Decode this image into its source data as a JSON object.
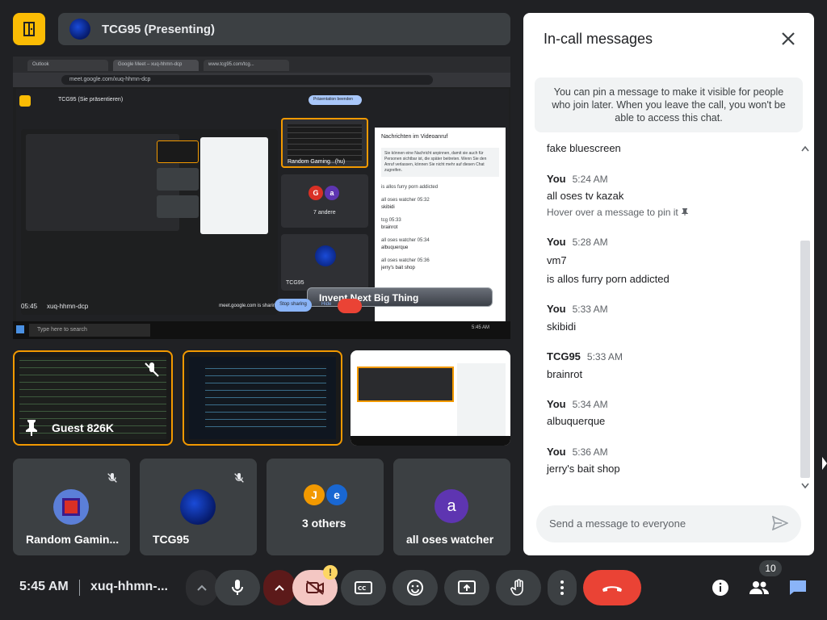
{
  "presenter_bar": {
    "title": "TCG95 (Presenting)"
  },
  "presentation": {
    "tabs": [
      "Outlook",
      "Google Meet – xuq-hhmn-dcp",
      "www.tcg95.com/tcg..."
    ],
    "url": "meet.google.com/xuq-hhmn-dcp",
    "inner_presenter": "TCG95 (Sie präsentieren)",
    "inner_present_btn": "Präsentation beenden",
    "inner_chat_title": "Nachrichten im Videoanruf",
    "inner_chat_info": "Sie können eine Nachricht anpinnen, damit sie auch für Personen sichtbar ist, die später beitreten. Wenn Sie den Anruf verlassen, können Sie nicht mehr auf diesen Chat zugreifen.",
    "inner_chat_lines": [
      "is allos furry porn addicted",
      "all oses watcher 05:32",
      "skibidi",
      "tcg 05:33",
      "brainrot",
      "all oses watcher 05:34",
      "albuquerque",
      "all oses watcher 05:36",
      "jerry's bait shop"
    ],
    "inner_tile_label": "Random Gaming...(hu)",
    "inner_others": "7 andere",
    "inner_tcg": "TCG95",
    "overlay_text": "Invent Next Big Thing",
    "bottom_time": "05:45",
    "bottom_code": "xuq-hhmn-dcp",
    "sharing_text": "meet.google.com is sharing your screen.",
    "stop_sharing": "Stop sharing",
    "hide": "Hide",
    "taskbar_search": "Type here to search",
    "taskbar_time": "5:45 AM"
  },
  "tiles_top": [
    {
      "label": "Guest 826K"
    }
  ],
  "participants": [
    {
      "name": "Random Gamin...",
      "muted": true
    },
    {
      "name": "TCG95",
      "muted": true
    },
    {
      "name": "3 others",
      "avatars": [
        "J",
        "e"
      ]
    },
    {
      "name": "all oses watcher",
      "avatar": "a"
    }
  ],
  "bottom": {
    "time": "5:45 AM",
    "meeting_code": "xuq-hhmn-...",
    "participants_count": "10",
    "camera_warning": "!"
  },
  "chat": {
    "title": "In-call messages",
    "pin_info": "You can pin a message to make it visible for people who join later. When you leave the call, you won't be able to access this chat.",
    "messages": [
      {
        "text": "fake bluescreen"
      },
      {
        "author": "You",
        "time": "5:24 AM",
        "lines": [
          "all oses tv kazak"
        ],
        "hint": "Hover over a message to pin it"
      },
      {
        "author": "You",
        "time": "5:28 AM",
        "lines": [
          "vm7",
          "is allos furry porn addicted"
        ]
      },
      {
        "author": "You",
        "time": "5:33 AM",
        "lines": [
          "skibidi"
        ]
      },
      {
        "author": "TCG95",
        "time": "5:33 AM",
        "lines": [
          "brainrot"
        ]
      },
      {
        "author": "You",
        "time": "5:34 AM",
        "lines": [
          "albuquerque"
        ]
      },
      {
        "author": "You",
        "time": "5:36 AM",
        "lines": [
          "jerry's bait shop"
        ]
      }
    ],
    "input_placeholder": "Send a message to everyone"
  },
  "colors": {
    "accent_yellow": "#fbbc04",
    "tile_border": "#f29900",
    "end_call": "#ea4335",
    "chat_icon": "#8ab4f8"
  }
}
